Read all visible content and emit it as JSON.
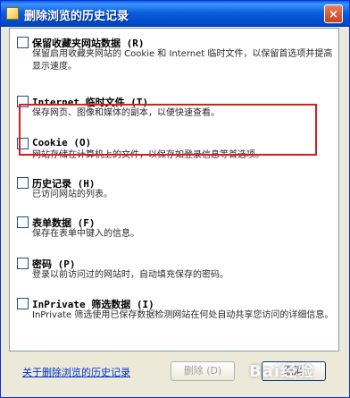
{
  "dialog": {
    "title": "删除浏览的历史记录",
    "close_label": "×"
  },
  "options": [
    {
      "label": "保留收藏夹网站数据 (R)",
      "desc": "保留启用收藏夹网站的 Cookie 和 Internet 临时文件，以保留首选项并提高显示速度。",
      "checked": false
    },
    {
      "label": "Internet 临时文件 (T)",
      "desc": "保存网页、图像和媒体的副本，以便快速查看。",
      "checked": false
    },
    {
      "label": "Cookie (O)",
      "desc": "网站存储在计算机上的文件，以保存如登录信息等首选项。",
      "checked": false
    },
    {
      "label": "历史记录 (H)",
      "desc": "已访问网站的列表。",
      "checked": false
    },
    {
      "label": "表单数据 (F)",
      "desc": "保存在表单中键入的信息。",
      "checked": false
    },
    {
      "label": "密码 (P)",
      "desc": "登录以前访问过的网站时，自动填充保存的密码。",
      "checked": false
    },
    {
      "label": "InPrivate 筛选数据 (I)",
      "desc": "InPrivate 筛选使用已保存数据检测网站在何处自动共享您访问的详细信息。",
      "checked": false
    }
  ],
  "footer": {
    "link": "关于删除浏览的历史记录",
    "delete_button": "删除 (D)",
    "cancel_button": "取消"
  },
  "watermark": "Bai经验"
}
